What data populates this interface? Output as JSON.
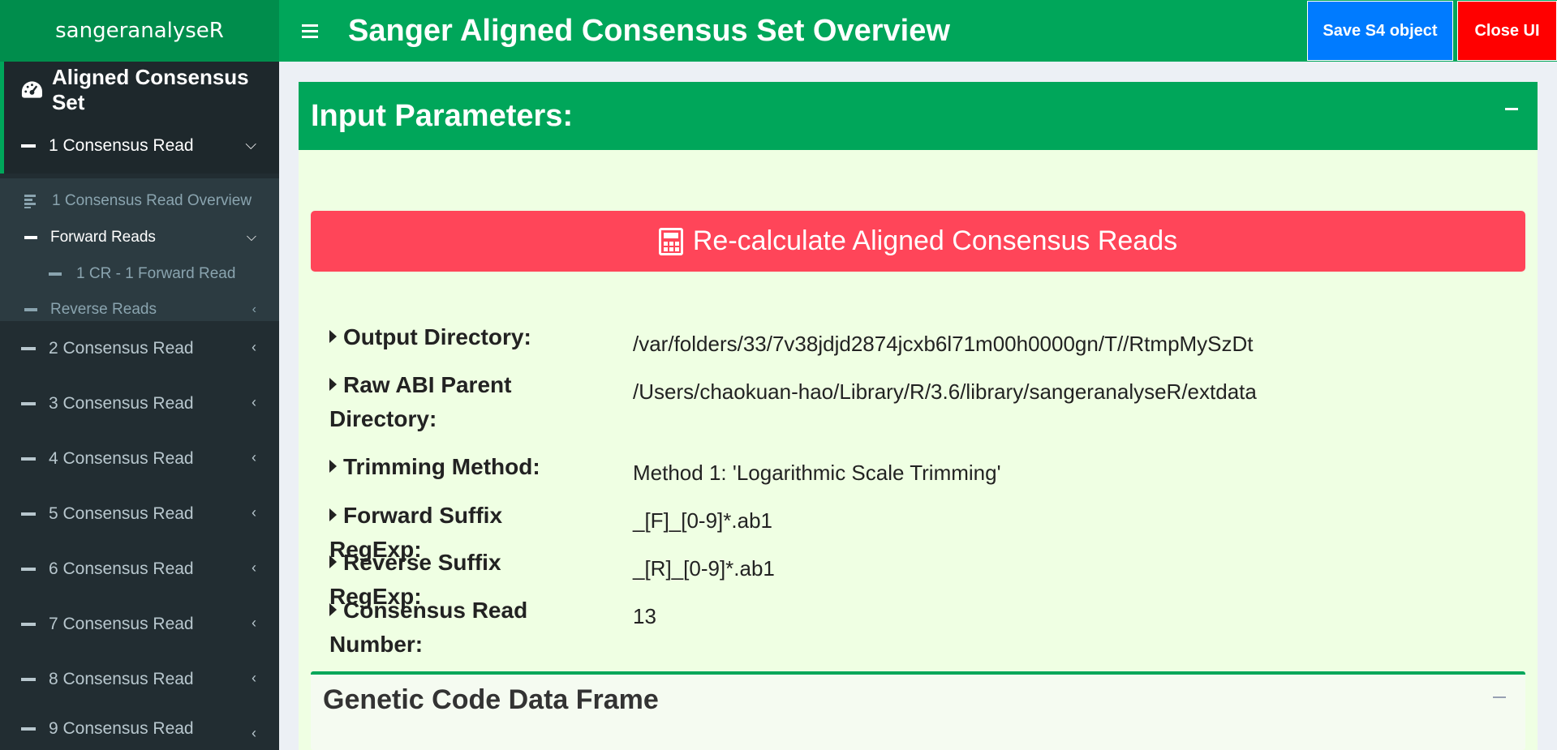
{
  "header": {
    "logo": "sangeranalyseR",
    "title": "Sanger Aligned Consensus Set Overview",
    "save_label": "Save S4 object",
    "close_label": "Close UI",
    "colors": {
      "logo_bg": "#008d4c",
      "bar_bg": "#00a65a",
      "save_bg": "#007bff",
      "close_bg": "#ff0000"
    }
  },
  "sidebar": {
    "header": "Aligned Consensus Set",
    "items": [
      {
        "label": "1 Consensus Read"
      },
      {
        "label": "2 Consensus Read"
      },
      {
        "label": "3 Consensus Read"
      },
      {
        "label": "4 Consensus Read"
      },
      {
        "label": "5 Consensus Read"
      },
      {
        "label": "6 Consensus Read"
      },
      {
        "label": "7 Consensus Read"
      },
      {
        "label": "8 Consensus Read"
      },
      {
        "label": "9 Consensus Read"
      }
    ],
    "submenu": {
      "overview": "1 Consensus Read Overview",
      "forward": "Forward Reads",
      "forward_child": "1 CR - 1 Forward Read",
      "reverse": "Reverse Reads"
    }
  },
  "panel": {
    "title": "Input Parameters:",
    "recalc_label": "Re-calculate Aligned Consensus Reads",
    "params": [
      {
        "label": "Output Directory:",
        "value": "/var/folders/33/7v38jdjd2874jcxb6l71m00h0000gn/T//RtmpMySzDt"
      },
      {
        "label": "Raw ABI Parent Directory:",
        "value": "/Users/chaokuan-hao/Library/R/3.6/library/sangeranalyseR/extdata"
      },
      {
        "label": "Trimming Method:",
        "value": "Method 1: 'Logarithmic Scale Trimming'"
      },
      {
        "label": "Forward Suffix RegExp:",
        "value": "_[F]_[0-9]*.ab1"
      },
      {
        "label": "Reverse Suffix RegExp:",
        "value": "_[R]_[0-9]*.ab1"
      },
      {
        "label": "Consensus Read Number:",
        "value": "13"
      }
    ],
    "subpanel_title": "Genetic Code Data Frame"
  }
}
